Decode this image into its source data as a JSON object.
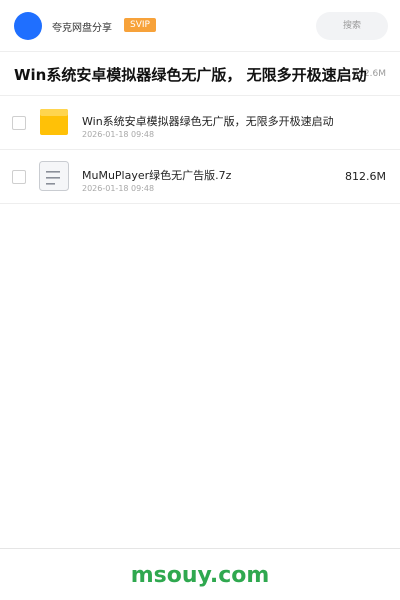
{
  "header": {
    "brand": "夸克网盘分享",
    "badge": "SVIP",
    "search_placeholder": "搜索"
  },
  "share": {
    "title": "Win系统安卓模拟器绿色无广版， 无限多开极速启动",
    "total_size": "812.6M"
  },
  "files": [
    {
      "type": "folder-icon",
      "name": "Win系统安卓模拟器绿色无广版，无限多开极速启动",
      "date": "2026-01-18 09:48",
      "size": ""
    },
    {
      "type": "archive-file-icon",
      "name": "MuMuPlayer绿色无广告版.7z",
      "date": "2026-01-18 09:48",
      "size": "812.6M"
    }
  ],
  "footer": {
    "watermark": "msouy.com"
  },
  "colors": {
    "avatar": "#1f6fff",
    "badge": "#f7a23a",
    "folder": "#ffc107",
    "watermark": "#2fa84f"
  }
}
